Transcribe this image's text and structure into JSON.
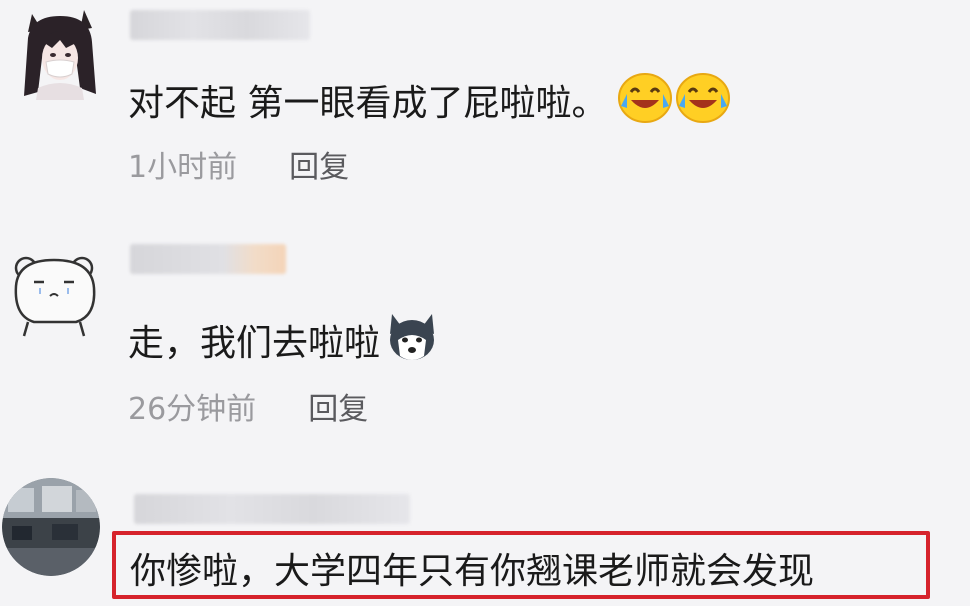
{
  "comments": [
    {
      "text": "对不起 第一眼看成了屁啦啦。",
      "emojis": [
        "laugh-cry-icon",
        "laugh-cry-icon"
      ],
      "time": "1小时前",
      "reply_label": "回复"
    },
    {
      "text": "走，我们去啦啦",
      "emojis": [
        "husky-icon"
      ],
      "time": "26分钟前",
      "reply_label": "回复"
    },
    {
      "text": "你惨啦，大学四年只有你翘课老师就会发现",
      "highlighted": true,
      "highlight_color": "#d6232c"
    }
  ]
}
